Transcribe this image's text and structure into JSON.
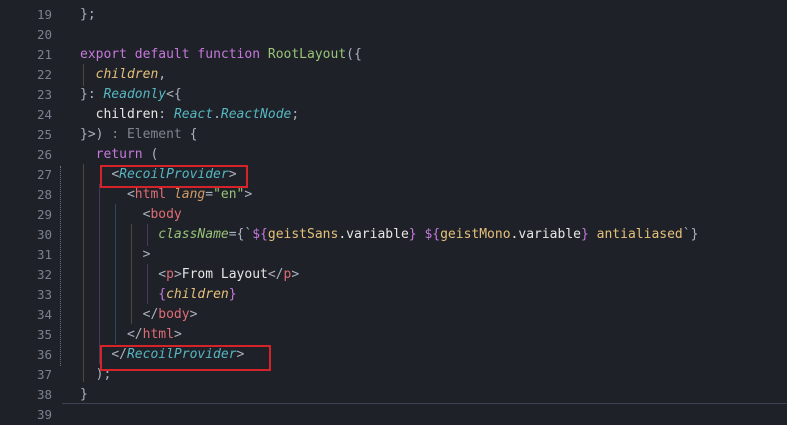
{
  "editor": {
    "lines": [
      {
        "num": "19",
        "tokens": [
          [
            "};",
            "#abb2bf",
            ""
          ]
        ]
      },
      {
        "num": "20",
        "tokens": []
      },
      {
        "num": "21",
        "tokens": [
          [
            "export ",
            "#c678dd",
            ""
          ],
          [
            "default ",
            "#c678dd",
            ""
          ],
          [
            "function ",
            "#c678dd",
            ""
          ],
          [
            "RootLayout",
            "#98c379",
            ""
          ],
          [
            "({",
            "#abb2bf",
            ""
          ]
        ]
      },
      {
        "num": "22",
        "tokens": [
          [
            "  ",
            null,
            ""
          ],
          [
            "children",
            "#e5c07b",
            "i"
          ],
          [
            ",",
            "#abb2bf",
            ""
          ]
        ]
      },
      {
        "num": "23",
        "tokens": [
          [
            "}",
            "#abb2bf",
            ""
          ],
          [
            ": ",
            "#abb2bf",
            ""
          ],
          [
            "Readonly",
            "#56b6c2",
            "i"
          ],
          [
            "<{",
            "#abb2bf",
            ""
          ]
        ]
      },
      {
        "num": "24",
        "tokens": [
          [
            "  children",
            "#e6e6e6",
            ""
          ],
          [
            ": ",
            "#abb2bf",
            ""
          ],
          [
            "React",
            "#56b6c2",
            "i"
          ],
          [
            ".",
            "#abb2bf",
            ""
          ],
          [
            "ReactNode",
            "#56b6c2",
            "i"
          ],
          [
            ";",
            "#abb2bf",
            ""
          ]
        ]
      },
      {
        "num": "25",
        "tokens": [
          [
            "}>)",
            "#abb2bf",
            ""
          ],
          [
            " : Element ",
            "#7f848e",
            ""
          ],
          [
            "{",
            "#abb2bf",
            ""
          ]
        ]
      },
      {
        "num": "26",
        "tokens": [
          [
            "  return ",
            "#c678dd",
            ""
          ],
          [
            "(",
            "#abb2bf",
            ""
          ]
        ]
      },
      {
        "num": "27",
        "tokens": [
          [
            "    ",
            null,
            ""
          ],
          [
            "<",
            "#abb2bf",
            ""
          ],
          [
            "RecoilProvider",
            "#56b6c2",
            "i"
          ],
          [
            ">",
            "#abb2bf",
            ""
          ]
        ]
      },
      {
        "num": "28",
        "tokens": [
          [
            "      ",
            null,
            ""
          ],
          [
            "<",
            "#abb2bf",
            ""
          ],
          [
            "html ",
            "#e06c75",
            ""
          ],
          [
            "lang",
            "#d19a66",
            "i"
          ],
          [
            "=",
            "#abb2bf",
            ""
          ],
          [
            "\"en\"",
            "#98c379",
            ""
          ],
          [
            ">",
            "#abb2bf",
            ""
          ]
        ]
      },
      {
        "num": "29",
        "tokens": [
          [
            "        ",
            null,
            ""
          ],
          [
            "<",
            "#abb2bf",
            ""
          ],
          [
            "body",
            "#e06c75",
            ""
          ]
        ]
      },
      {
        "num": "30",
        "tokens": [
          [
            "          ",
            null,
            ""
          ],
          [
            "className",
            "#98c379",
            "i"
          ],
          [
            "={`",
            "#abb2bf",
            ""
          ],
          [
            "${",
            "#c678dd",
            ""
          ],
          [
            "geistSans",
            "#e5c07b",
            ""
          ],
          [
            ".variable",
            "#e6e6e6",
            ""
          ],
          [
            "} ",
            "#c678dd",
            ""
          ],
          [
            "${",
            "#c678dd",
            ""
          ],
          [
            "geistMono",
            "#e5c07b",
            ""
          ],
          [
            ".variable",
            "#e6e6e6",
            ""
          ],
          [
            "} ",
            "#c678dd",
            ""
          ],
          [
            "antialiased",
            "#e5c07b",
            ""
          ],
          [
            "`}",
            "#abb2bf",
            ""
          ]
        ]
      },
      {
        "num": "31",
        "tokens": [
          [
            "        ",
            null,
            ""
          ],
          [
            ">",
            "#abb2bf",
            ""
          ]
        ]
      },
      {
        "num": "32",
        "tokens": [
          [
            "          ",
            null,
            ""
          ],
          [
            "<",
            "#abb2bf",
            ""
          ],
          [
            "p",
            "#e06c75",
            ""
          ],
          [
            ">",
            "#abb2bf",
            ""
          ],
          [
            "From Layout",
            "#e6e6e6",
            ""
          ],
          [
            "</",
            "#abb2bf",
            ""
          ],
          [
            "p",
            "#e06c75",
            ""
          ],
          [
            ">",
            "#abb2bf",
            ""
          ]
        ]
      },
      {
        "num": "33",
        "tokens": [
          [
            "          ",
            null,
            ""
          ],
          [
            "{",
            "#c678dd",
            ""
          ],
          [
            "children",
            "#e5c07b",
            "i"
          ],
          [
            "}",
            "#c678dd",
            ""
          ]
        ]
      },
      {
        "num": "34",
        "tokens": [
          [
            "        ",
            null,
            ""
          ],
          [
            "</",
            "#abb2bf",
            ""
          ],
          [
            "body",
            "#e06c75",
            ""
          ],
          [
            ">",
            "#abb2bf",
            ""
          ]
        ]
      },
      {
        "num": "35",
        "tokens": [
          [
            "      ",
            null,
            ""
          ],
          [
            "</",
            "#abb2bf",
            ""
          ],
          [
            "html",
            "#e06c75",
            ""
          ],
          [
            ">",
            "#abb2bf",
            ""
          ]
        ]
      },
      {
        "num": "36",
        "tokens": [
          [
            "    ",
            null,
            ""
          ],
          [
            "</",
            "#abb2bf",
            ""
          ],
          [
            "RecoilProvider",
            "#56b6c2",
            "i"
          ],
          [
            ">",
            "#abb2bf",
            ""
          ]
        ]
      },
      {
        "num": "37",
        "tokens": [
          [
            "  );",
            "#abb2bf",
            ""
          ]
        ]
      },
      {
        "num": "38",
        "tokens": [
          [
            "}",
            "#abb2bf",
            ""
          ]
        ]
      },
      {
        "num": "39",
        "tokens": []
      }
    ]
  }
}
